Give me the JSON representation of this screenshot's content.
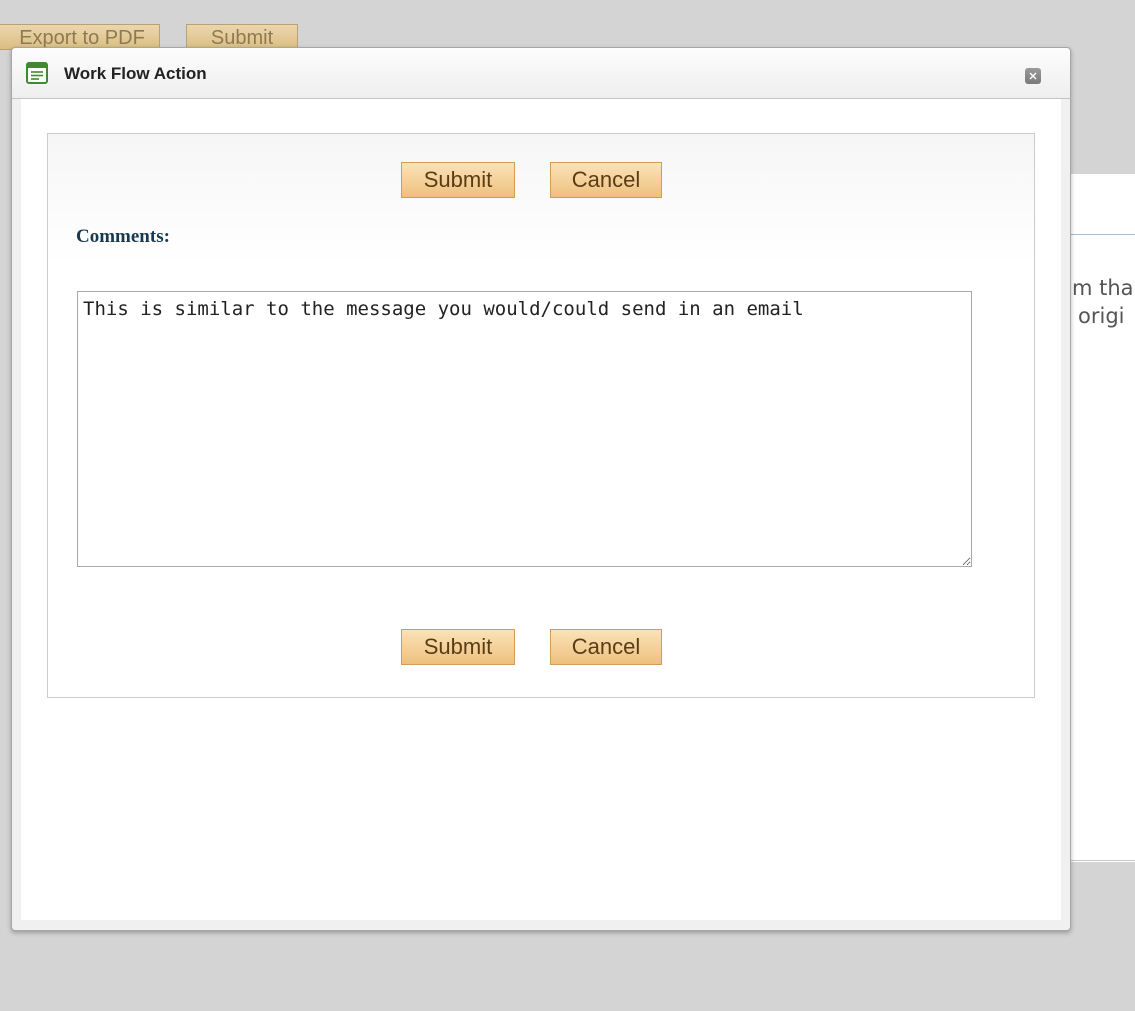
{
  "background": {
    "toolbar": {
      "export_label": "Export to PDF",
      "submit_label": "Submit"
    },
    "text_line_1": "m tha",
    "text_line_2": "origi"
  },
  "dialog": {
    "title": "Work Flow Action",
    "title_icon": "form-icon",
    "close_icon": "close-icon",
    "top_actions": {
      "submit_label": "Submit",
      "cancel_label": "Cancel"
    },
    "comments": {
      "label": "Comments:",
      "value": "This is similar to the message you would/could send in an email"
    },
    "bottom_actions": {
      "submit_label": "Submit",
      "cancel_label": "Cancel"
    }
  },
  "colors": {
    "button_gradient_top": "#fbe3b8",
    "button_gradient_bottom": "#eec07f",
    "label_color": "#18394f",
    "icon_green": "#3f8a2f"
  }
}
